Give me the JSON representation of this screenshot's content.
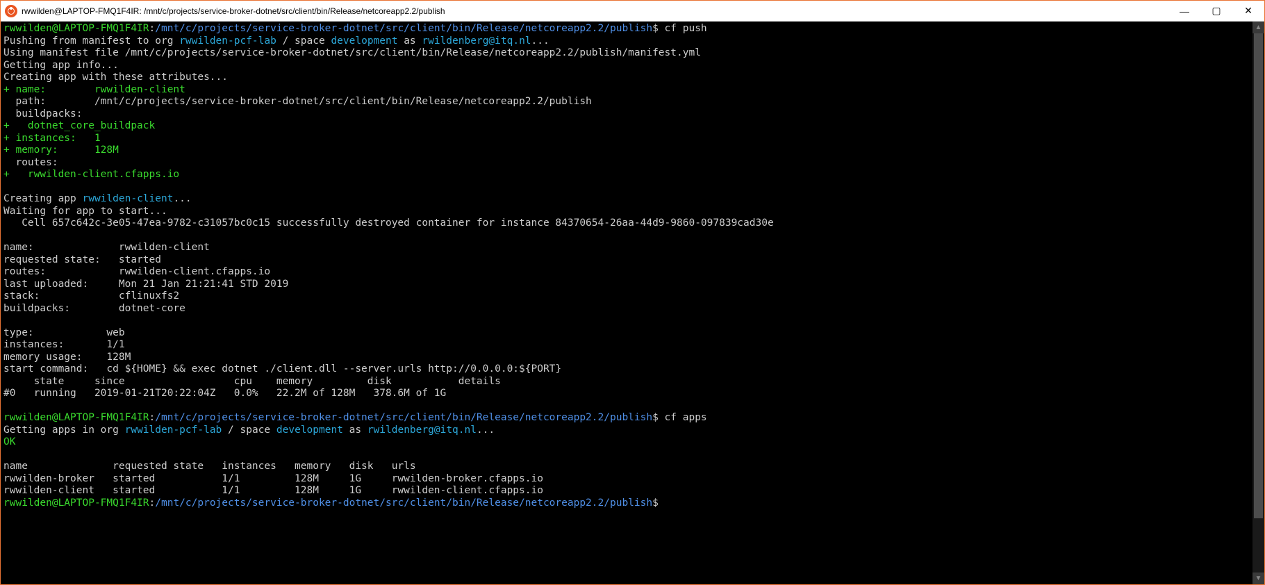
{
  "titlebar": {
    "title": "rwwilden@LAPTOP-FMQ1F4IR: /mnt/c/projects/service-broker-dotnet/src/client/bin/Release/netcoreapp2.2/publish",
    "icon": "ubuntu-icon",
    "min": "—",
    "max": "▢",
    "close": "✕"
  },
  "prompt": {
    "user": "rwwilden@LAPTOP-FMQ1F4IR",
    "sep": ":",
    "path": "/mnt/c/projects/service-broker-dotnet/src/client/bin/Release/netcoreapp2.2/publish",
    "sigil": "$"
  },
  "cmds": {
    "cf_push": " cf push",
    "cf_apps": " cf apps",
    "blank": " "
  },
  "push": {
    "l1a": "Pushing from manifest to org ",
    "l1b": "rwwilden-pcf-lab",
    "l1c": " / space ",
    "l1d": "development",
    "l1e": " as ",
    "l1f": "rwildenberg@itq.nl",
    "l1g": "...",
    "l2": "Using manifest file /mnt/c/projects/service-broker-dotnet/src/client/bin/Release/netcoreapp2.2/publish/manifest.yml",
    "l3": "Getting app info...",
    "l4": "Creating app with these attributes...",
    "name": "+ name:        rwwilden-client",
    "path": "  path:        /mnt/c/projects/service-broker-dotnet/src/client/bin/Release/netcoreapp2.2/publish",
    "buildpacks": "  buildpacks:",
    "bp1": "+   dotnet_core_buildpack",
    "instances": "+ instances:   1",
    "memory": "+ memory:      128M",
    "routes": "  routes:",
    "route1": "+   rwwilden-client.cfapps.io",
    "creatinga": "Creating app ",
    "creatingb": "rwwilden-client",
    "creatingc": "...",
    "waiting": "Waiting for app to start...",
    "cell": "   Cell 657c642c-3e05-47ea-9782-c31057bc0c15 successfully destroyed container for instance 84370654-26aa-44d9-9860-097839cad30e"
  },
  "status": {
    "name": "name:              rwwilden-client",
    "reqstate": "requested state:   started",
    "routes": "routes:            rwwilden-client.cfapps.io",
    "uploaded": "last uploaded:     Mon 21 Jan 21:21:41 STD 2019",
    "stack": "stack:             cflinuxfs2",
    "bps": "buildpacks:        dotnet-core",
    "type": "type:            web",
    "inst": "instances:       1/1",
    "mem": "memory usage:    128M",
    "startcmd": "start command:   cd ${HOME} && exec dotnet ./client.dll --server.urls http://0.0.0.0:${PORT}",
    "header": "     state     since                  cpu    memory         disk           details",
    "row": "#0   running   2019-01-21T20:22:04Z   0.0%   22.2M of 128M   378.6M of 1G"
  },
  "apps": {
    "l1a": "Getting apps in org ",
    "l1b": "rwwilden-pcf-lab",
    "l1c": " / space ",
    "l1d": "development",
    "l1e": " as ",
    "l1f": "rwildenberg@itq.nl",
    "l1g": "...",
    "ok": "OK",
    "header": "name              requested state   instances   memory   disk   urls",
    "r1": "rwwilden-broker   started           1/1         128M     1G     rwwilden-broker.cfapps.io",
    "r2": "rwwilden-client   started           1/1         128M     1G     rwwilden-client.cfapps.io"
  },
  "sb": {
    "up": "▲",
    "down": "▼"
  }
}
